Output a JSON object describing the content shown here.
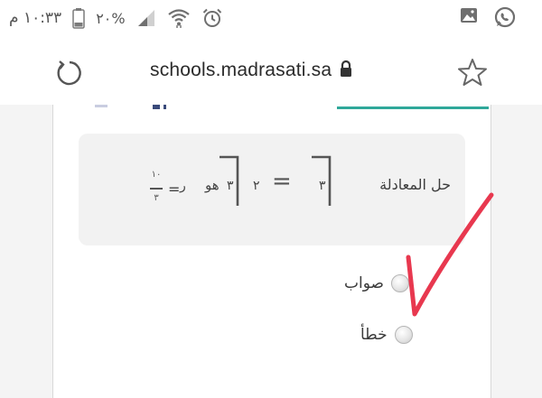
{
  "status_bar": {
    "time": "١٠:٣٣ م",
    "battery_percent": "%٢٠",
    "icons": [
      "whatsapp-icon",
      "gallery-icon",
      "alarm-icon",
      "wifi-icon",
      "signal-icon",
      "battery-icon"
    ]
  },
  "browser": {
    "url": "schools.madrasati.sa",
    "icons": [
      "reload-icon",
      "lock-icon",
      "star-icon"
    ]
  },
  "question": {
    "label": "حل المعادلة",
    "equation": {
      "left_coef": "٣",
      "equals": "=",
      "right_coef": "٢",
      "right_inner": "٣",
      "word": "هو",
      "var": "ر",
      "eq2": "=",
      "frac_num": "١٠",
      "frac_den": "٣"
    }
  },
  "options": [
    {
      "label": "صواب",
      "selected": false
    },
    {
      "label": "خطأ",
      "selected": false
    }
  ],
  "colors": {
    "accent": "#2fa89a",
    "checkmark": "#e8384f"
  }
}
